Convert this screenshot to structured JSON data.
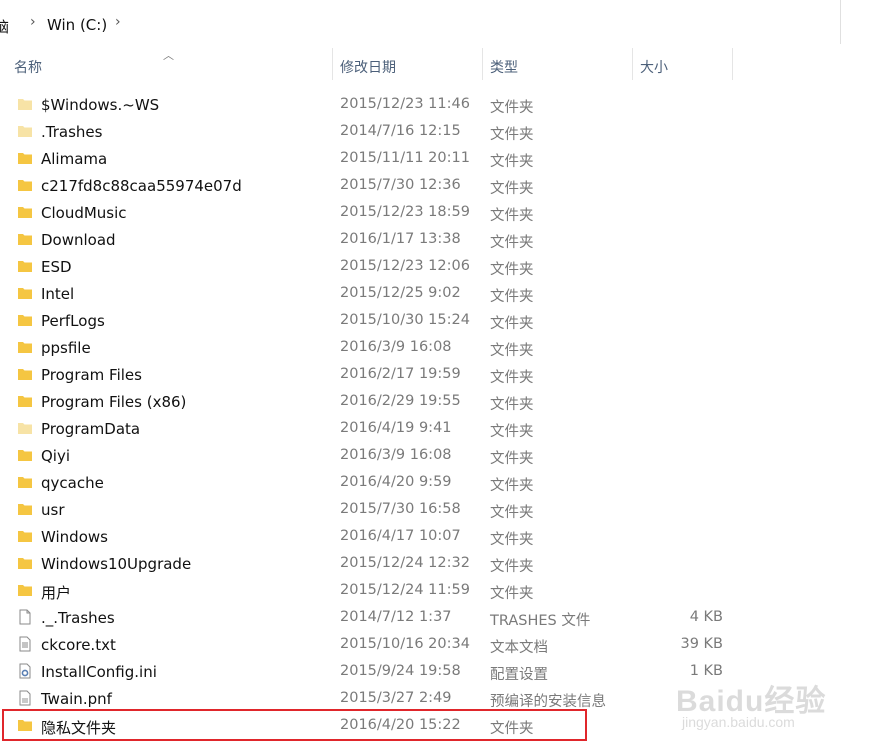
{
  "breadcrumb": {
    "parent": "脑",
    "current": "Win (C:)",
    "separator": "›"
  },
  "columns": {
    "name": "名称",
    "date": "修改日期",
    "type": "类型",
    "size": "大小"
  },
  "files": [
    {
      "name": "$Windows.~WS",
      "date": "2015/12/23 11:46",
      "type": "文件夹",
      "size": "",
      "icon": "folder-pale-icon"
    },
    {
      "name": ".Trashes",
      "date": "2014/7/16 12:15",
      "type": "文件夹",
      "size": "",
      "icon": "folder-pale-icon"
    },
    {
      "name": "Alimama",
      "date": "2015/11/11 20:11",
      "type": "文件夹",
      "size": "",
      "icon": "folder-icon"
    },
    {
      "name": "c217fd8c88caa55974e07d",
      "date": "2015/7/30 12:36",
      "type": "文件夹",
      "size": "",
      "icon": "folder-icon"
    },
    {
      "name": "CloudMusic",
      "date": "2015/12/23 18:59",
      "type": "文件夹",
      "size": "",
      "icon": "folder-icon"
    },
    {
      "name": "Download",
      "date": "2016/1/17 13:38",
      "type": "文件夹",
      "size": "",
      "icon": "folder-icon"
    },
    {
      "name": "ESD",
      "date": "2015/12/23 12:06",
      "type": "文件夹",
      "size": "",
      "icon": "folder-icon"
    },
    {
      "name": "Intel",
      "date": "2015/12/25 9:02",
      "type": "文件夹",
      "size": "",
      "icon": "folder-icon"
    },
    {
      "name": "PerfLogs",
      "date": "2015/10/30 15:24",
      "type": "文件夹",
      "size": "",
      "icon": "folder-icon"
    },
    {
      "name": "ppsfile",
      "date": "2016/3/9 16:08",
      "type": "文件夹",
      "size": "",
      "icon": "folder-icon"
    },
    {
      "name": "Program Files",
      "date": "2016/2/17 19:59",
      "type": "文件夹",
      "size": "",
      "icon": "folder-icon"
    },
    {
      "name": "Program Files (x86)",
      "date": "2016/2/29 19:55",
      "type": "文件夹",
      "size": "",
      "icon": "folder-icon"
    },
    {
      "name": "ProgramData",
      "date": "2016/4/19 9:41",
      "type": "文件夹",
      "size": "",
      "icon": "folder-pale-icon"
    },
    {
      "name": "Qiyi",
      "date": "2016/3/9 16:08",
      "type": "文件夹",
      "size": "",
      "icon": "folder-icon"
    },
    {
      "name": "qycache",
      "date": "2016/4/20 9:59",
      "type": "文件夹",
      "size": "",
      "icon": "folder-icon"
    },
    {
      "name": "usr",
      "date": "2015/7/30 16:58",
      "type": "文件夹",
      "size": "",
      "icon": "folder-icon"
    },
    {
      "name": "Windows",
      "date": "2016/4/17 10:07",
      "type": "文件夹",
      "size": "",
      "icon": "folder-icon"
    },
    {
      "name": "Windows10Upgrade",
      "date": "2015/12/24 12:32",
      "type": "文件夹",
      "size": "",
      "icon": "folder-icon"
    },
    {
      "name": "用户",
      "date": "2015/12/24 11:59",
      "type": "文件夹",
      "size": "",
      "icon": "folder-icon"
    },
    {
      "name": "._.Trashes",
      "date": "2014/7/12 1:37",
      "type": "TRASHES 文件",
      "size": "4 KB",
      "icon": "blank-file-icon"
    },
    {
      "name": "ckcore.txt",
      "date": "2015/10/16 20:34",
      "type": "文本文档",
      "size": "39 KB",
      "icon": "text-file-icon"
    },
    {
      "name": "InstallConfig.ini",
      "date": "2015/9/24 19:58",
      "type": "配置设置",
      "size": "1 KB",
      "icon": "config-file-icon"
    },
    {
      "name": "Twain.pnf",
      "date": "2015/3/27 2:49",
      "type": "预编译的安装信息",
      "size": "",
      "icon": "setup-file-icon"
    },
    {
      "name": "隐私文件夹",
      "date": "2016/4/20 15:22",
      "type": "文件夹",
      "size": "",
      "icon": "folder-icon"
    }
  ],
  "watermark": {
    "brand": "Baidu经验",
    "url": "jingyan.baidu.com"
  },
  "colors": {
    "folder": "#f4c542",
    "folder_pale": "#f7e3a6",
    "header_text": "#4c607a",
    "highlight": "#e0262b"
  }
}
